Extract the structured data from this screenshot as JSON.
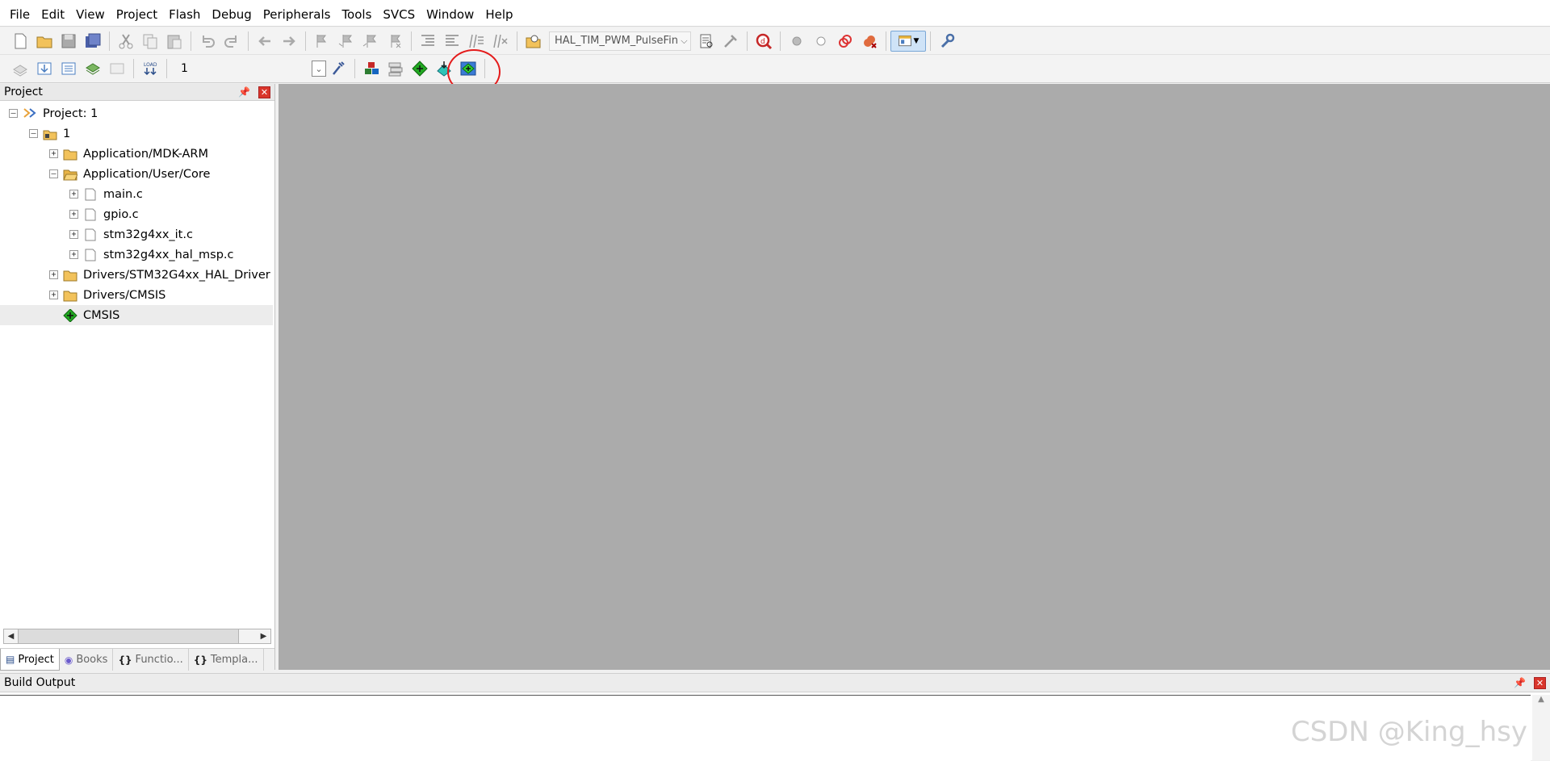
{
  "menu": [
    "File",
    "Edit",
    "View",
    "Project",
    "Flash",
    "Debug",
    "Peripherals",
    "Tools",
    "SVCS",
    "Window",
    "Help"
  ],
  "toolbar": {
    "find_combo_value": "HAL_TIM_PWM_PulseFin",
    "target_select_value": "1"
  },
  "annotation": {
    "label": "1",
    "color": "#e41b1b"
  },
  "project_panel": {
    "title": "Project",
    "tree": [
      {
        "label": "Project: 1"
      },
      {
        "label": "1"
      },
      {
        "label": "Application/MDK-ARM"
      },
      {
        "label": "Application/User/Core"
      },
      {
        "label": "main.c"
      },
      {
        "label": "gpio.c"
      },
      {
        "label": "stm32g4xx_it.c"
      },
      {
        "label": "stm32g4xx_hal_msp.c"
      },
      {
        "label": "Drivers/STM32G4xx_HAL_Driver"
      },
      {
        "label": "Drivers/CMSIS"
      },
      {
        "label": "CMSIS"
      }
    ],
    "tabs": [
      "Project",
      "Books",
      "Functio...",
      "Templa..."
    ]
  },
  "build_output": {
    "title": "Build Output"
  },
  "watermark": "CSDN @King_hsy"
}
